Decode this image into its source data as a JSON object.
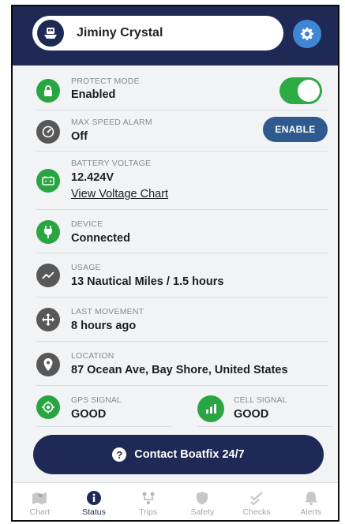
{
  "boat": {
    "name": "Jiminy Crystal"
  },
  "status_items": {
    "protect_mode": {
      "label": "PROTECT MODE",
      "value": "Enabled",
      "toggle_on": true
    },
    "max_speed_alarm": {
      "label": "MAX SPEED ALARM",
      "value": "Off",
      "button": "ENABLE"
    },
    "battery_voltage": {
      "label": "BATTERY VOLTAGE",
      "value": "12.424V",
      "link": "View Voltage Chart"
    },
    "device": {
      "label": "DEVICE",
      "value": "Connected"
    },
    "usage": {
      "label": "USAGE",
      "value": "13 Nautical Miles / 1.5 hours"
    },
    "last_movement": {
      "label": "LAST MOVEMENT",
      "value": "8 hours ago"
    },
    "location": {
      "label": "LOCATION",
      "value": "87 Ocean Ave, Bay Shore, United States"
    },
    "gps_signal": {
      "label": "GPS SIGNAL",
      "value": "GOOD"
    },
    "cell_signal": {
      "label": "CELL SIGNAL",
      "value": "GOOD"
    }
  },
  "contact": {
    "label": "Contact Boatfix 24/7",
    "icon": "question-icon"
  },
  "tabs": [
    {
      "label": "Chart",
      "icon": "map-icon",
      "active": false
    },
    {
      "label": "Status",
      "icon": "info-icon",
      "active": true
    },
    {
      "label": "Trips",
      "icon": "route-icon",
      "active": false
    },
    {
      "label": "Safety",
      "icon": "shield-icon",
      "active": false
    },
    {
      "label": "Checks",
      "icon": "checklist-icon",
      "active": false
    },
    {
      "label": "Alerts",
      "icon": "bell-icon",
      "active": false
    }
  ],
  "colors": {
    "navy": "#1e2a55",
    "green": "#29a642",
    "gray": "#585858",
    "accent_blue": "#3f86d4"
  }
}
